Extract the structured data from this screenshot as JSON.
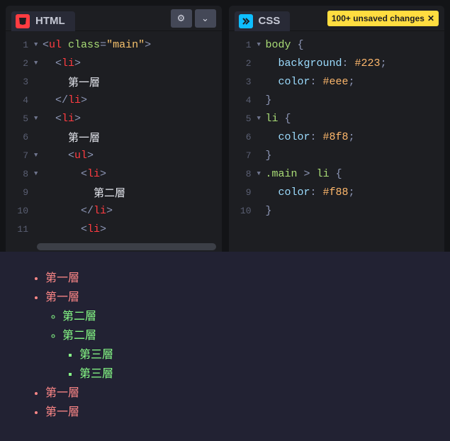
{
  "panels": {
    "html": {
      "title": "HTML",
      "badge_color": "#ff3c41",
      "lines": [
        {
          "n": 1,
          "fold": "▼",
          "indent": 0,
          "html": "<span class='t-br'>&lt;</span><span class='t-tag'>ul</span> <span class='t-attr'>class</span><span class='t-br'>=</span><span class='t-str'>\"main\"</span><span class='t-br'>&gt;</span>"
        },
        {
          "n": 2,
          "fold": "▼",
          "indent": 1,
          "html": "<span class='t-br'>&lt;</span><span class='t-tag'>li</span><span class='t-br'>&gt;</span>"
        },
        {
          "n": 3,
          "fold": "",
          "indent": 2,
          "html": "<span class='t-txt'>第一層</span>"
        },
        {
          "n": 4,
          "fold": "",
          "indent": 1,
          "html": "<span class='t-br'>&lt;/</span><span class='t-tag'>li</span><span class='t-br'>&gt;</span>"
        },
        {
          "n": 5,
          "fold": "▼",
          "indent": 1,
          "html": "<span class='t-br'>&lt;</span><span class='t-tag'>li</span><span class='t-br'>&gt;</span>"
        },
        {
          "n": 6,
          "fold": "",
          "indent": 2,
          "html": "<span class='t-txt'>第一層</span>"
        },
        {
          "n": 7,
          "fold": "▼",
          "indent": 2,
          "html": "<span class='t-br'>&lt;</span><span class='t-tag'>ul</span><span class='t-br'>&gt;</span>"
        },
        {
          "n": 8,
          "fold": "▼",
          "indent": 3,
          "html": "<span class='t-br'>&lt;</span><span class='t-tag'>li</span><span class='t-br'>&gt;</span>"
        },
        {
          "n": 9,
          "fold": "",
          "indent": 4,
          "html": "<span class='t-txt'>第二層</span>"
        },
        {
          "n": 10,
          "fold": "",
          "indent": 3,
          "html": "<span class='t-br'>&lt;/</span><span class='t-tag'>li</span><span class='t-br'>&gt;</span>"
        },
        {
          "n": 11,
          "fold": "",
          "indent": 3,
          "html": "<span class='t-br'>&lt;</span><span class='t-tag'>li</span><span class='t-br'>&gt;</span>"
        }
      ]
    },
    "css": {
      "title": "CSS",
      "badge_color": "#0ebeff",
      "unsaved_label": "100+ unsaved changes",
      "lines": [
        {
          "n": 1,
          "fold": "▼",
          "indent": 0,
          "html": "<span class='t-sel'>body</span> <span class='t-br'>{</span>"
        },
        {
          "n": 2,
          "fold": "",
          "indent": 1,
          "html": "<span class='t-prop'>background</span><span class='t-br'>:</span> <span class='t-val'>#223</span><span class='t-br'>;</span>"
        },
        {
          "n": 3,
          "fold": "",
          "indent": 1,
          "html": "<span class='t-prop'>color</span><span class='t-br'>:</span> <span class='t-val'>#eee</span><span class='t-br'>;</span>"
        },
        {
          "n": 4,
          "fold": "",
          "indent": 0,
          "html": "<span class='t-br'>}</span>"
        },
        {
          "n": 5,
          "fold": "▼",
          "indent": 0,
          "html": "<span class='t-sel'>li</span> <span class='t-br'>{</span>"
        },
        {
          "n": 6,
          "fold": "",
          "indent": 1,
          "html": "<span class='t-prop'>color</span><span class='t-br'>:</span> <span class='t-val'>#8f8</span><span class='t-br'>;</span>"
        },
        {
          "n": 7,
          "fold": "",
          "indent": 0,
          "html": "<span class='t-br'>}</span>"
        },
        {
          "n": 8,
          "fold": "▼",
          "indent": 0,
          "html": "<span class='t-sel'>.main</span> <span class='t-br'>&gt;</span> <span class='t-sel'>li</span> <span class='t-br'>{</span>"
        },
        {
          "n": 9,
          "fold": "",
          "indent": 1,
          "html": "<span class='t-prop'>color</span><span class='t-br'>:</span> <span class='t-val'>#f88</span><span class='t-br'>;</span>"
        },
        {
          "n": 10,
          "fold": "",
          "indent": 0,
          "html": "<span class='t-br'>}</span>"
        }
      ]
    }
  },
  "preview": {
    "bg": "#222233",
    "fg": "#eeeeee",
    "level1_color": "#ff8888",
    "child_color": "#88ff88",
    "items": {
      "l1a": "第一層",
      "l1b": "第一層",
      "l2a": "第二層",
      "l2b": "第二層",
      "l3a": "第三層",
      "l3b": "第三層",
      "l1c": "第一層",
      "l1d": "第一層"
    }
  }
}
